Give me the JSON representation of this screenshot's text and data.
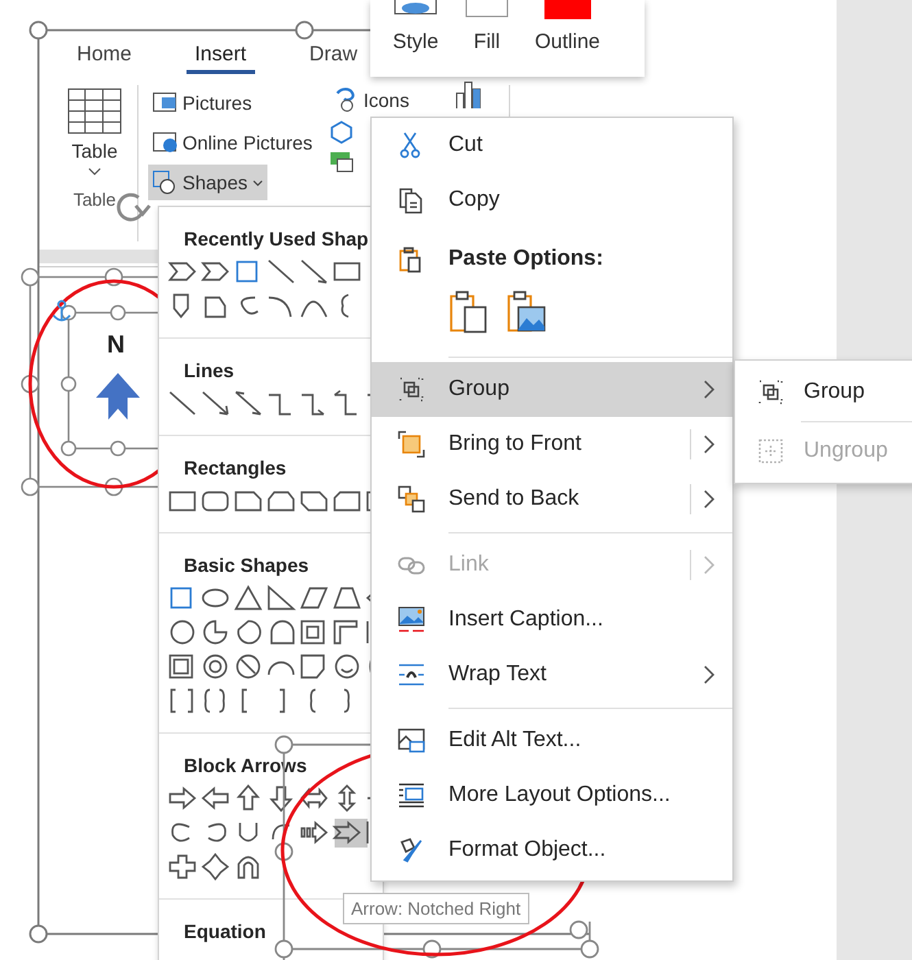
{
  "ribbon": {
    "tabs": [
      {
        "label": "Home",
        "selected": false
      },
      {
        "label": "Insert",
        "selected": true
      },
      {
        "label": "Draw",
        "selected": false
      }
    ],
    "table_button": "Table",
    "group_label": "Table",
    "commands": [
      {
        "label": "Pictures",
        "selected": false
      },
      {
        "label": "Online Pictures",
        "selected": false
      },
      {
        "label": "Shapes",
        "selected": true
      }
    ],
    "more_commands": [
      "Icons"
    ]
  },
  "mini_toolbar": [
    {
      "label": "Style",
      "kind": "style"
    },
    {
      "label": "Fill",
      "kind": "fill"
    },
    {
      "label": "Outline",
      "kind": "outline"
    }
  ],
  "shapes_gallery": [
    {
      "title": "Recently Used Shap",
      "kind": "recent"
    },
    {
      "title": "Lines",
      "kind": "lines"
    },
    {
      "title": "Rectangles",
      "kind": "rectangles"
    },
    {
      "title": "Basic Shapes",
      "kind": "basic"
    },
    {
      "title": "Block Arrows",
      "kind": "arrows"
    },
    {
      "title": "Equation",
      "kind": "equation"
    }
  ],
  "canvas": {
    "label": "N"
  },
  "context_menu": [
    {
      "kind": "item",
      "label": "Cut",
      "disabled": false,
      "selected": false,
      "submenu": false,
      "split": false
    },
    {
      "kind": "item",
      "label": "Copy",
      "disabled": false,
      "selected": false,
      "submenu": false,
      "split": false
    },
    {
      "kind": "header",
      "label": "Paste Options:"
    },
    {
      "kind": "paste"
    },
    {
      "kind": "separator"
    },
    {
      "kind": "item",
      "label": "Group",
      "disabled": false,
      "selected": true,
      "submenu": true,
      "split": false
    },
    {
      "kind": "item",
      "label": "Bring to Front",
      "disabled": false,
      "selected": false,
      "submenu": true,
      "split": true
    },
    {
      "kind": "item",
      "label": "Send to Back",
      "disabled": false,
      "selected": false,
      "submenu": true,
      "split": true
    },
    {
      "kind": "separator"
    },
    {
      "kind": "item",
      "label": "Link",
      "disabled": true,
      "selected": false,
      "submenu": true,
      "split": true
    },
    {
      "kind": "item",
      "label": "Insert Caption...",
      "disabled": false,
      "selected": false,
      "submenu": false,
      "split": false
    },
    {
      "kind": "item",
      "label": "Wrap Text",
      "disabled": false,
      "selected": false,
      "submenu": true,
      "split": false
    },
    {
      "kind": "separator"
    },
    {
      "kind": "item",
      "label": "Edit Alt Text...",
      "disabled": false,
      "selected": false,
      "submenu": false,
      "split": false
    },
    {
      "kind": "item",
      "label": "More Layout Options...",
      "disabled": false,
      "selected": false,
      "submenu": false,
      "split": false
    },
    {
      "kind": "item",
      "label": "Format Object...",
      "disabled": false,
      "selected": false,
      "submenu": false,
      "split": false
    }
  ],
  "submenu": [
    {
      "label": "Group",
      "disabled": false
    },
    {
      "label": "Ungroup",
      "disabled": true
    }
  ],
  "tooltip": "Arrow: Notched Right"
}
